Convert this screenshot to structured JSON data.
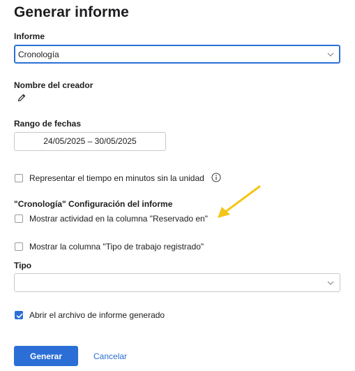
{
  "title": "Generar informe",
  "report": {
    "label": "Informe",
    "value": "Cronología"
  },
  "creator": {
    "label": "Nombre del creador",
    "edit_icon": "pencil-icon"
  },
  "date_range": {
    "label": "Rango de fechas",
    "value": "24/05/2025 – 30/05/2025"
  },
  "time_minutes": {
    "label": "Representar el tiempo en minutos sin la unidad",
    "checked": false,
    "info_icon": "info-icon"
  },
  "section": {
    "title": "\"Cronología\" Configuración del informe"
  },
  "options": {
    "show_activity": {
      "label": "Mostrar actividad en la columna \"Reservado en\"",
      "checked": false
    },
    "show_work_type": {
      "label": "Mostrar la columna \"Tipo de trabajo registrado\"",
      "checked": false
    }
  },
  "type": {
    "label": "Tipo",
    "value": ""
  },
  "open_file": {
    "label": "Abrir el archivo de informe generado",
    "checked": true
  },
  "buttons": {
    "generate": "Generar",
    "cancel": "Cancelar"
  },
  "colors": {
    "accent": "#2b6fd6",
    "annotation_arrow": "#f5c518"
  }
}
